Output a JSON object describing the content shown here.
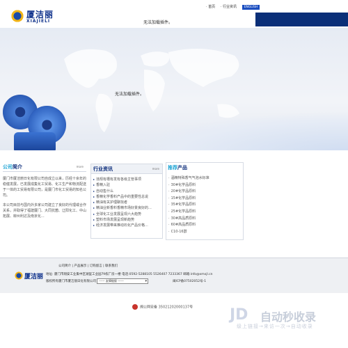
{
  "header": {
    "logo_text_cn": "厦洁丽",
    "logo_text_en": "XIAJIELI",
    "plugin_notice": "无法加载插件。",
    "nav": {
      "home": "首页",
      "news": "行业资讯",
      "english": "ENGLISH"
    }
  },
  "banner": {
    "plugin_notice": "无法加载插件。"
  },
  "company": {
    "title_hl": "公司",
    "title_rest": "简介",
    "more": "more",
    "para1": "厦门市厦洁丽日化有限公司自成立以来，历经十余年的稳健发展，已发展成集化工贸易、化工生产和物流配送于一体的工贸易有限公司，是厦门市化工贸易的知名公司。",
    "para2": "本公司目前与国内外多家公司建立了良好的代理或合作关系，并取得了福建厦门、大同抗菌、辽阳化工、中山拓展、柳州利达及南京化..."
  },
  "industry": {
    "title": "行业资讯",
    "more": "more",
    "items": [
      "违规有槽有发有各级主管事项",
      "香精入驻",
      "自动售什么",
      "香精化学香料产品中的重要性总说",
      "精油有关护理聊找者",
      "精油业新香料香精市场好景良好的...",
      "全球化工业发展呈现六大趋势",
      "塑料市场发展呈现新趋势",
      "经济发展带来推动石化产品价格..."
    ]
  },
  "products": {
    "title_hl": "推荐",
    "title_rest": "产品",
    "items": [
      "酒精特殊香气气泡水标准",
      "30#化学品原料",
      "20#化学品原料",
      "15#化学品原料",
      "35#化学品原料",
      "25#化学品原料",
      "30#高品质原料",
      "60#高品质原料",
      "C10-16醇"
    ]
  },
  "footer": {
    "logo_text": "厦洁丽",
    "links": "公司简介 | 产品展示 | 订购留言 | 联系我们",
    "address": "地址: 厦门市翔安工业集中区湖里工业园79栋厂房一楼  电话:0592-5288105 5526407 7233367  邮箱:info@xmxjl.cn",
    "copyright": "版权所有厦门市厦洁丽日化有限公司",
    "select_value": "------ 友情链接 ------",
    "icp": "闽ICP备07502052号-1",
    "police": "闽公网安备 35021202000137号"
  },
  "watermark": {
    "brand": "JD",
    "text_cn": "自动秒收录",
    "sub": "级上链接→来访一次→自动收录"
  }
}
